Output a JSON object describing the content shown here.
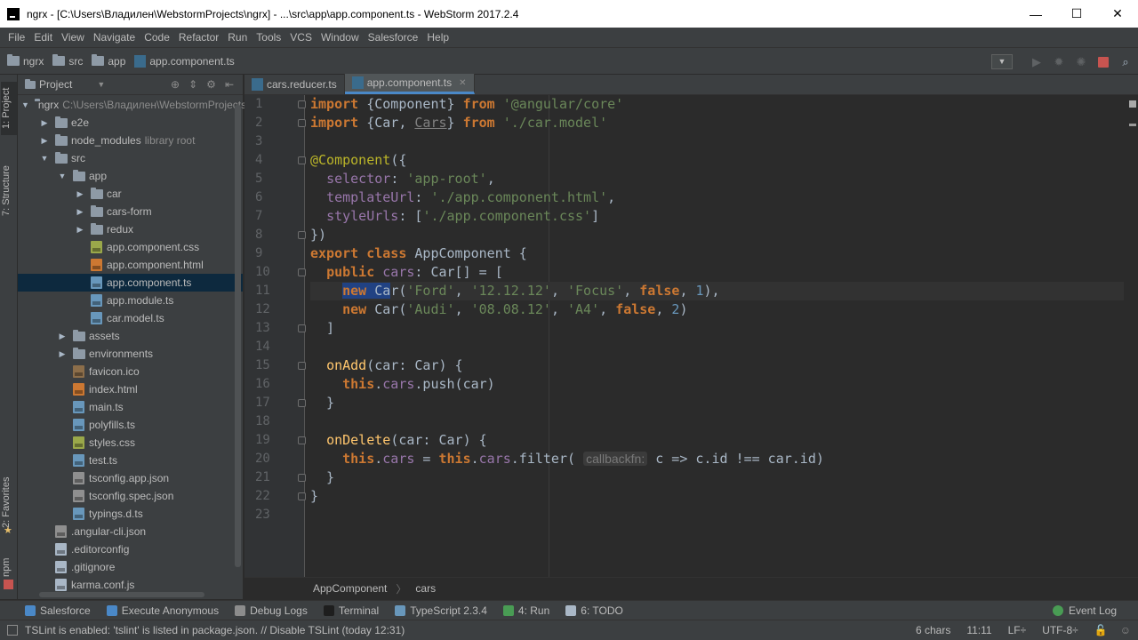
{
  "window": {
    "title": "ngrx - [C:\\Users\\Владилен\\WebstormProjects\\ngrx] - ...\\src\\app\\app.component.ts - WebStorm 2017.2.4",
    "minimize": "—",
    "maximize": "☐",
    "close": "✕"
  },
  "menu": [
    "File",
    "Edit",
    "View",
    "Navigate",
    "Code",
    "Refactor",
    "Run",
    "Tools",
    "VCS",
    "Window",
    "Salesforce",
    "Help"
  ],
  "navbar": {
    "crumbs": [
      "ngrx",
      "src",
      "app",
      "app.component.ts"
    ]
  },
  "project_panel": {
    "title": "Project",
    "tree": [
      {
        "label": "ngrx",
        "extra": "C:\\Users\\Владилен\\WebstormProjects\\ngrx",
        "indent": 0,
        "arrow": "▼",
        "icon": "folder"
      },
      {
        "label": "e2e",
        "indent": 1,
        "arrow": "▶",
        "icon": "folder"
      },
      {
        "label": "node_modules",
        "extra": "library root",
        "indent": 1,
        "arrow": "▶",
        "icon": "folder"
      },
      {
        "label": "src",
        "indent": 1,
        "arrow": "▼",
        "icon": "folder"
      },
      {
        "label": "app",
        "indent": 2,
        "arrow": "▼",
        "icon": "folder"
      },
      {
        "label": "car",
        "indent": 3,
        "arrow": "▶",
        "icon": "folder"
      },
      {
        "label": "cars-form",
        "indent": 3,
        "arrow": "▶",
        "icon": "folder"
      },
      {
        "label": "redux",
        "indent": 3,
        "arrow": "▶",
        "icon": "folder"
      },
      {
        "label": "app.component.css",
        "indent": 3,
        "arrow": "",
        "icon": "css"
      },
      {
        "label": "app.component.html",
        "indent": 3,
        "arrow": "",
        "icon": "html"
      },
      {
        "label": "app.component.ts",
        "indent": 3,
        "arrow": "",
        "icon": "ts",
        "selected": true
      },
      {
        "label": "app.module.ts",
        "indent": 3,
        "arrow": "",
        "icon": "ts"
      },
      {
        "label": "car.model.ts",
        "indent": 3,
        "arrow": "",
        "icon": "ts"
      },
      {
        "label": "assets",
        "indent": 2,
        "arrow": "▶",
        "icon": "folder"
      },
      {
        "label": "environments",
        "indent": 2,
        "arrow": "▶",
        "icon": "folder"
      },
      {
        "label": "favicon.ico",
        "indent": 2,
        "arrow": "",
        "icon": "ico"
      },
      {
        "label": "index.html",
        "indent": 2,
        "arrow": "",
        "icon": "html"
      },
      {
        "label": "main.ts",
        "indent": 2,
        "arrow": "",
        "icon": "ts"
      },
      {
        "label": "polyfills.ts",
        "indent": 2,
        "arrow": "",
        "icon": "ts"
      },
      {
        "label": "styles.css",
        "indent": 2,
        "arrow": "",
        "icon": "css"
      },
      {
        "label": "test.ts",
        "indent": 2,
        "arrow": "",
        "icon": "ts"
      },
      {
        "label": "tsconfig.app.json",
        "indent": 2,
        "arrow": "",
        "icon": "json"
      },
      {
        "label": "tsconfig.spec.json",
        "indent": 2,
        "arrow": "",
        "icon": "json"
      },
      {
        "label": "typings.d.ts",
        "indent": 2,
        "arrow": "",
        "icon": "ts"
      },
      {
        "label": ".angular-cli.json",
        "indent": 1,
        "arrow": "",
        "icon": "json"
      },
      {
        "label": ".editorconfig",
        "indent": 1,
        "arrow": "",
        "icon": "txt"
      },
      {
        "label": ".gitignore",
        "indent": 1,
        "arrow": "",
        "icon": "txt"
      },
      {
        "label": "karma.conf.js",
        "indent": 1,
        "arrow": "",
        "icon": "txt"
      }
    ]
  },
  "side_tabs": {
    "project": "1: Project",
    "structure": "7: Structure",
    "favorites": "2: Favorites",
    "npm": "npm"
  },
  "tabs": [
    {
      "label": "cars.reducer.ts",
      "active": false
    },
    {
      "label": "app.component.ts",
      "active": true
    }
  ],
  "line_numbers": [
    "1",
    "2",
    "3",
    "4",
    "5",
    "6",
    "7",
    "8",
    "9",
    "10",
    "11",
    "12",
    "13",
    "14",
    "15",
    "16",
    "17",
    "18",
    "19",
    "20",
    "21",
    "22",
    "23"
  ],
  "code_hint": "callbackfn:",
  "breadcrumbs": [
    "AppComponent",
    "cars"
  ],
  "tool_windows": [
    {
      "label": "Salesforce",
      "color": "#4a88c7"
    },
    {
      "label": "Execute Anonymous",
      "color": "#4a88c7"
    },
    {
      "label": "Debug Logs",
      "color": "#8c8c8c"
    },
    {
      "label": "Terminal",
      "color": "#1e1e1e"
    },
    {
      "label": "TypeScript 2.3.4",
      "color": "#6897bb"
    },
    {
      "label": "4: Run",
      "color": "#499c54"
    },
    {
      "label": "6: TODO",
      "color": "#a9b7c6"
    }
  ],
  "event_log": "Event Log",
  "status": {
    "message": "TSLint is enabled: 'tslint' is listed in package.json. // Disable TSLint (today 12:31)",
    "chars": "6 chars",
    "position": "11:11",
    "line_sep": "LF÷",
    "encoding": "UTF-8÷"
  }
}
